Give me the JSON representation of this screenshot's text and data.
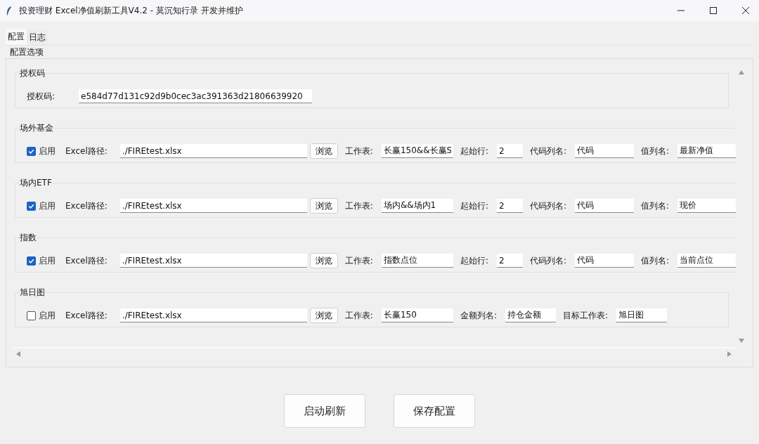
{
  "window": {
    "title": "投资理财 Excel净值刷新工具V4.2 - 莫沉知行录 开发并维护"
  },
  "tabs": [
    {
      "label": "配置",
      "selected": true
    },
    {
      "label": "日志",
      "selected": false
    }
  ],
  "panel_title": "配置选项",
  "sections": [
    {
      "title": "授权码",
      "items": [
        {
          "kind": "label",
          "text": "授权码:"
        },
        {
          "kind": "license",
          "value": "e584d77d131c92d9b0cec3ac391363d21806639920"
        }
      ]
    },
    {
      "title": "场外基金",
      "items": [
        {
          "kind": "checkbox",
          "text": "启用",
          "checked": true
        },
        {
          "kind": "label",
          "text": "Excel路径:"
        },
        {
          "kind": "path",
          "value": "./FIREtest.xlsx"
        },
        {
          "kind": "button",
          "text": "浏览"
        },
        {
          "kind": "label",
          "text": "工作表:"
        },
        {
          "kind": "sheet",
          "value": "长赢150&&长赢S"
        },
        {
          "kind": "label",
          "text": "起始行:"
        },
        {
          "kind": "row",
          "value": "2"
        },
        {
          "kind": "label",
          "text": "代码列名:"
        },
        {
          "kind": "name",
          "value": "代码"
        },
        {
          "kind": "label",
          "text": "值列名:"
        },
        {
          "kind": "name",
          "value": "最新净值"
        }
      ]
    },
    {
      "title": "场内ETF",
      "items": [
        {
          "kind": "checkbox",
          "text": "启用",
          "checked": true
        },
        {
          "kind": "label",
          "text": "Excel路径:"
        },
        {
          "kind": "path",
          "value": "./FIREtest.xlsx"
        },
        {
          "kind": "button",
          "text": "浏览"
        },
        {
          "kind": "label",
          "text": "工作表:"
        },
        {
          "kind": "sheet",
          "value": "场内&&场内1"
        },
        {
          "kind": "label",
          "text": "起始行:"
        },
        {
          "kind": "row",
          "value": "2"
        },
        {
          "kind": "label",
          "text": "代码列名:"
        },
        {
          "kind": "name",
          "value": "代码"
        },
        {
          "kind": "label",
          "text": "值列名:"
        },
        {
          "kind": "name",
          "value": "现价"
        }
      ]
    },
    {
      "title": "指数",
      "items": [
        {
          "kind": "checkbox",
          "text": "启用",
          "checked": true
        },
        {
          "kind": "label",
          "text": "Excel路径:"
        },
        {
          "kind": "path",
          "value": "./FIREtest.xlsx"
        },
        {
          "kind": "button",
          "text": "浏览"
        },
        {
          "kind": "label",
          "text": "工作表:"
        },
        {
          "kind": "sheet",
          "value": "指数点位"
        },
        {
          "kind": "label",
          "text": "起始行:"
        },
        {
          "kind": "row",
          "value": "2"
        },
        {
          "kind": "label",
          "text": "代码列名:"
        },
        {
          "kind": "name",
          "value": "代码"
        },
        {
          "kind": "label",
          "text": "值列名:"
        },
        {
          "kind": "name",
          "value": "当前点位"
        }
      ]
    },
    {
      "title": "旭日图",
      "items": [
        {
          "kind": "checkbox",
          "text": "启用",
          "checked": false
        },
        {
          "kind": "label",
          "text": "Excel路径:"
        },
        {
          "kind": "path",
          "value": "./FIREtest.xlsx"
        },
        {
          "kind": "button",
          "text": "浏览"
        },
        {
          "kind": "label",
          "text": "工作表:"
        },
        {
          "kind": "sheet",
          "value": "长赢150"
        },
        {
          "kind": "label",
          "text": "金额列名:"
        },
        {
          "kind": "short",
          "value": "持仓金额"
        },
        {
          "kind": "label",
          "text": "目标工作表:"
        },
        {
          "kind": "short",
          "value": "旭日图"
        }
      ]
    }
  ],
  "buttons": [
    "启动刷新",
    "保存配置"
  ]
}
